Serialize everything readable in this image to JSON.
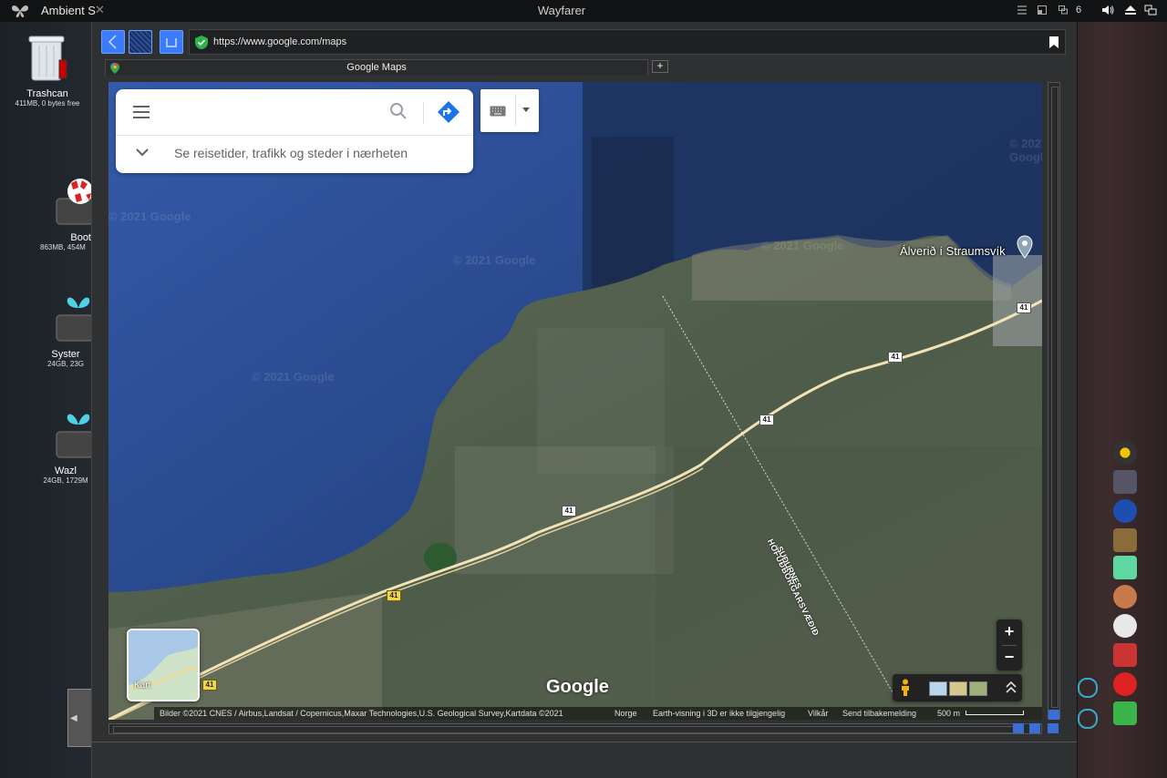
{
  "topbar": {
    "app_name": "Ambient S",
    "window_title": "Wayfarer",
    "workspace_count": "6"
  },
  "desktop_icons": [
    {
      "label": "Trashcan",
      "sub": "411MB, 0 bytes free"
    },
    {
      "label": "Boot",
      "sub": "863MB, 454M"
    },
    {
      "label": "Syster",
      "sub": "24GB, 23G"
    },
    {
      "label": "Wazl",
      "sub": "24GB, 1729M"
    }
  ],
  "browser": {
    "url": "https://www.google.com/maps",
    "tab_title": "Google Maps",
    "new_tab_label": "+"
  },
  "map": {
    "search_placeholder": "",
    "hint": "Se reisetider, trafikk og steder i nærheten",
    "place_label": "Álverið í Straumsvík",
    "border_label_line1": "HÖFUÐBORGARSVÆÐIÐ",
    "border_label_line2": "SUÐURNES",
    "road_number": "41",
    "watermark": "© 2021 Google",
    "minimap_label": "Kart",
    "logo": "Google",
    "zoom_in": "+",
    "zoom_out": "−",
    "attribution": {
      "imagery": "Bilder ©2021 CNES / Airbus,Landsat / Copernicus,Maxar Technologies,U.S. Geological Survey,Kartdata ©2021",
      "region": "Norge",
      "earth_note": "Earth-visning i 3D er ikke tilgjengelig",
      "terms": "Vilkår",
      "feedback": "Send tilbakemelding",
      "scale": "500 m"
    }
  },
  "colors": {
    "accent": "#3b7bff",
    "sea": "#2c4a8a",
    "land": "#4e5a4a"
  }
}
